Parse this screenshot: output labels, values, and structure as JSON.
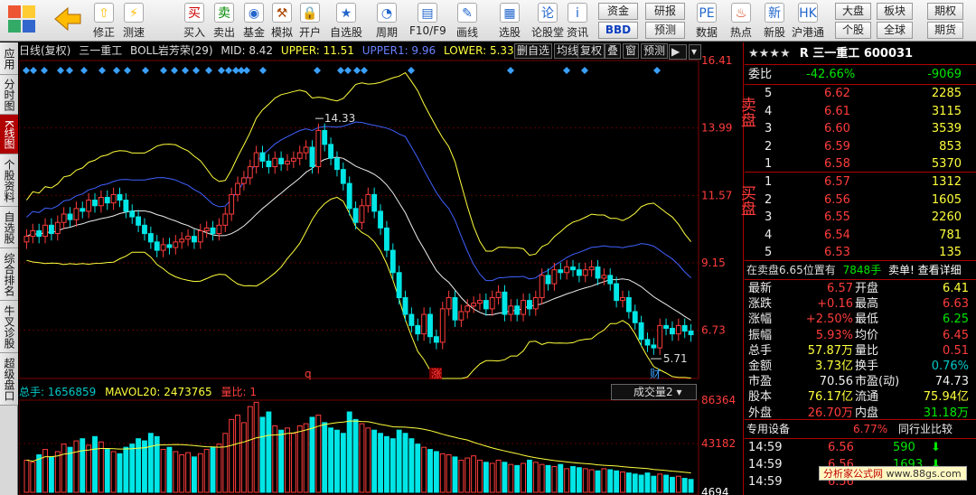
{
  "toolbar": {
    "buttons": [
      {
        "label": "修正",
        "icon": "⇧"
      },
      {
        "label": "测速",
        "icon": "⚡"
      },
      {
        "label": "买入",
        "icon": "买"
      },
      {
        "label": "卖出",
        "icon": "卖"
      },
      {
        "label": "基金",
        "icon": "◉"
      },
      {
        "label": "模拟",
        "icon": "⚒"
      },
      {
        "label": "开户",
        "icon": "🔒"
      },
      {
        "label": "自选股",
        "icon": "★"
      },
      {
        "label": "周期",
        "icon": "◔"
      },
      {
        "label": "F10/F9",
        "icon": "▤"
      },
      {
        "label": "画线",
        "icon": "✎"
      },
      {
        "label": "选股",
        "icon": "▦"
      },
      {
        "label": "论股堂",
        "icon": "论"
      },
      {
        "label": "资讯",
        "icon": "i"
      },
      {
        "label": "数据",
        "icon": "PE"
      },
      {
        "label": "热点",
        "icon": "♨"
      },
      {
        "label": "新股",
        "icon": "新"
      },
      {
        "label": "沪港通",
        "icon": "HK"
      }
    ],
    "mini": {
      "zijin": "资金",
      "bbd": "BBD",
      "yanbao": "研报",
      "yuce": "预测",
      "dapan": "大盘",
      "geigu": "个股",
      "bankuai": "板块",
      "quanqiu": "全球",
      "qiquan": "期权",
      "qihuo": "期货"
    }
  },
  "sidebar": [
    "应用",
    "分时图",
    "K线图",
    "个股资料",
    "自选股",
    "综合排名",
    "牛叉诊股",
    "超级盘口"
  ],
  "chart": {
    "info": {
      "period": "日线(复权)",
      "name": "三一重工",
      "indicator": "BOLL岩芳荣(29)",
      "mid": "MID: 8.42",
      "upper": "UPPER: 11.51",
      "upper1": "UPPER1: 9.96",
      "lower": "LOWER: 5.33"
    },
    "controls": [
      "删自选",
      "均线",
      "复权",
      "叠",
      "窗",
      "预测"
    ],
    "price_ticks": [
      "16.41",
      "13.99",
      "11.57",
      "9.15",
      "6.73"
    ],
    "annot_high": "14.33",
    "annot_low": "5.71",
    "markers": [
      "q",
      "涨",
      "财"
    ],
    "vol_info": {
      "total": "总手: 1656859",
      "mavol": "MAVOL20: 2473765",
      "ratio": "量比: 1"
    },
    "vol_select": "成交量2",
    "vol_ticks": [
      "86364",
      "43182",
      "4694"
    ]
  },
  "chart_data": {
    "type": "candlestick",
    "ylim": [
      5.0,
      16.41
    ],
    "closes": [
      10.1,
      10.3,
      10.1,
      10.5,
      10.2,
      10.6,
      10.9,
      10.7,
      11.1,
      11.0,
      11.4,
      11.2,
      11.5,
      11.3,
      11.6,
      11.4,
      11.0,
      10.8,
      10.5,
      10.2,
      9.9,
      9.6,
      9.8,
      9.7,
      9.9,
      10.0,
      10.1,
      9.9,
      10.3,
      10.4,
      10.2,
      10.5,
      10.9,
      11.6,
      12.0,
      12.2,
      12.6,
      13.1,
      12.8,
      12.6,
      12.9,
      12.7,
      12.8,
      12.9,
      13.1,
      13.3,
      12.6,
      13.9,
      13.4,
      12.9,
      12.5,
      12.0,
      11.1,
      10.6,
      11.2,
      11.6,
      11.0,
      10.4,
      9.6,
      8.8,
      7.9,
      7.3,
      6.9,
      6.6,
      7.3,
      6.5,
      6.3,
      7.5,
      7.9,
      7.1,
      7.4,
      7.6,
      7.7,
      7.8,
      7.5,
      7.9,
      8.1,
      7.3,
      7.6,
      7.3,
      7.8,
      7.5,
      7.9,
      8.7,
      8.4,
      8.9,
      8.8,
      9.0,
      8.9,
      8.7,
      8.9,
      9.0,
      8.6,
      8.7,
      8.4,
      7.8,
      7.9,
      7.4,
      7.0,
      6.4,
      6.2,
      6.1,
      6.9,
      6.8,
      6.6,
      6.9,
      6.7,
      6.57
    ],
    "volumes": [
      30,
      28,
      35,
      40,
      33,
      38,
      45,
      42,
      48,
      50,
      44,
      52,
      47,
      40,
      38,
      36,
      42,
      45,
      50,
      48,
      55,
      52,
      40,
      42,
      38,
      35,
      37,
      33,
      36,
      40,
      42,
      45,
      55,
      68,
      72,
      65,
      80,
      84,
      70,
      75,
      62,
      58,
      60,
      55,
      62,
      64,
      70,
      72,
      65,
      60,
      58,
      55,
      75,
      68,
      64,
      60,
      58,
      55,
      52,
      50,
      58,
      55,
      50,
      45,
      42,
      40,
      38,
      36,
      35,
      33,
      30,
      32,
      34,
      30,
      28,
      27,
      30,
      28,
      26,
      25,
      27,
      30,
      28,
      26,
      25,
      24,
      26,
      22,
      24,
      23,
      22,
      21,
      20,
      22,
      21,
      20,
      19,
      18,
      17,
      16,
      18,
      15,
      17,
      16,
      14,
      15,
      13,
      12
    ],
    "y_unit": "price"
  },
  "right": {
    "stars": "★★★★",
    "title": "R 三一重工  600031",
    "weibi": {
      "label": "委比",
      "pct": "-42.66%",
      "diff": "-9069"
    },
    "sell_label": "卖盘",
    "buy_label": "买盘",
    "sell": [
      [
        "5",
        "6.62",
        "2285"
      ],
      [
        "4",
        "6.61",
        "3115"
      ],
      [
        "3",
        "6.60",
        "3539"
      ],
      [
        "2",
        "6.59",
        "853"
      ],
      [
        "1",
        "6.58",
        "5370"
      ]
    ],
    "buy": [
      [
        "1",
        "6.57",
        "1312"
      ],
      [
        "2",
        "6.56",
        "1605"
      ],
      [
        "3",
        "6.55",
        "2260"
      ],
      [
        "4",
        "6.54",
        "781"
      ],
      [
        "5",
        "6.53",
        "135"
      ]
    ],
    "notice": {
      "text": "在卖盘6.65位置有",
      "vol": "7848手",
      "action": "卖单!",
      "link": "查看详细"
    },
    "stats": [
      [
        "最新",
        "6.57",
        "开盘",
        "6.41"
      ],
      [
        "涨跌",
        "+0.16",
        "最高",
        "6.63"
      ],
      [
        "涨幅",
        "+2.50%",
        "最低",
        "6.25"
      ],
      [
        "振幅",
        "5.93%",
        "均价",
        "6.45"
      ],
      [
        "总手",
        "57.87万",
        "量比",
        "0.51"
      ],
      [
        "金额",
        "3.73亿",
        "换手",
        "0.76%"
      ],
      [
        "市盈",
        "70.56",
        "市盈(动)",
        "74.73"
      ],
      [
        "股本",
        "76.17亿",
        "流通",
        "75.94亿"
      ],
      [
        "外盘",
        "26.70万",
        "内盘",
        "31.18万"
      ]
    ],
    "sector": {
      "name": "专用设备",
      "pct": "6.77%",
      "compare": "同行业比较"
    },
    "ticks": [
      [
        "14:59",
        "6.56",
        "590"
      ],
      [
        "14:59",
        "6.56",
        "1693"
      ],
      [
        "14:59",
        "6.56",
        ""
      ]
    ]
  },
  "brand": {
    "name": "分析家公式网",
    "url": "www.88gs.com"
  }
}
